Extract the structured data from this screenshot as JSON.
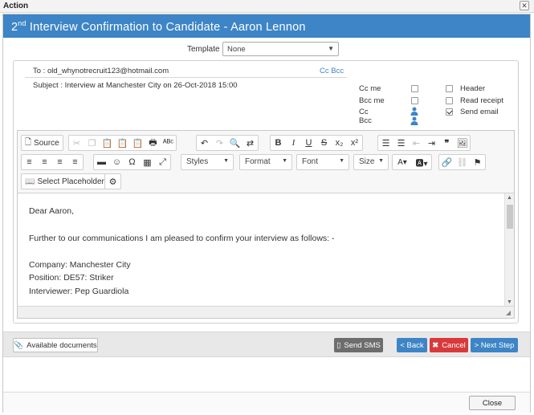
{
  "window": {
    "title": "Action"
  },
  "dialog": {
    "title_sup": "nd",
    "title_pre": "2",
    "title_rest": " Interview Confirmation to Candidate - Aaron Lennon"
  },
  "template": {
    "label": "Template",
    "value": "None"
  },
  "email": {
    "to": "To : old_whynotrecruit123@hotmail.com",
    "cc_bcc_link": "Cc Bcc",
    "subject": "Subject : Interview at Manchester City on 26-Oct-2018  15:00"
  },
  "options": {
    "cc_me": "Cc me",
    "bcc_me": "Bcc me",
    "cc": "Cc",
    "bcc": "Bcc",
    "header": "Header",
    "read_receipt": "Read receipt",
    "send_email": "Send email"
  },
  "toolbar": {
    "source": "Source",
    "styles": "Styles",
    "format": "Format",
    "font": "Font",
    "size": "Size",
    "select_placeholder": "Select Placeholder"
  },
  "body": {
    "greeting": "Dear Aaron,",
    "intro": "Further to our communications I am pleased to confirm your interview as follows: -",
    "company": "Company: Manchester City",
    "position": "Position: DE57: Striker",
    "interviewer": "Interviewer: Pep Guardiola"
  },
  "footer": {
    "available_documents": "Available documents",
    "send_sms": "Send SMS",
    "back": "< Back",
    "cancel": "Cancel",
    "next_step": "> Next Step"
  },
  "close": "Close",
  "colors": {
    "accent": "#3d85c6",
    "danger": "#d9393a",
    "sms": "#6d6d6d"
  }
}
